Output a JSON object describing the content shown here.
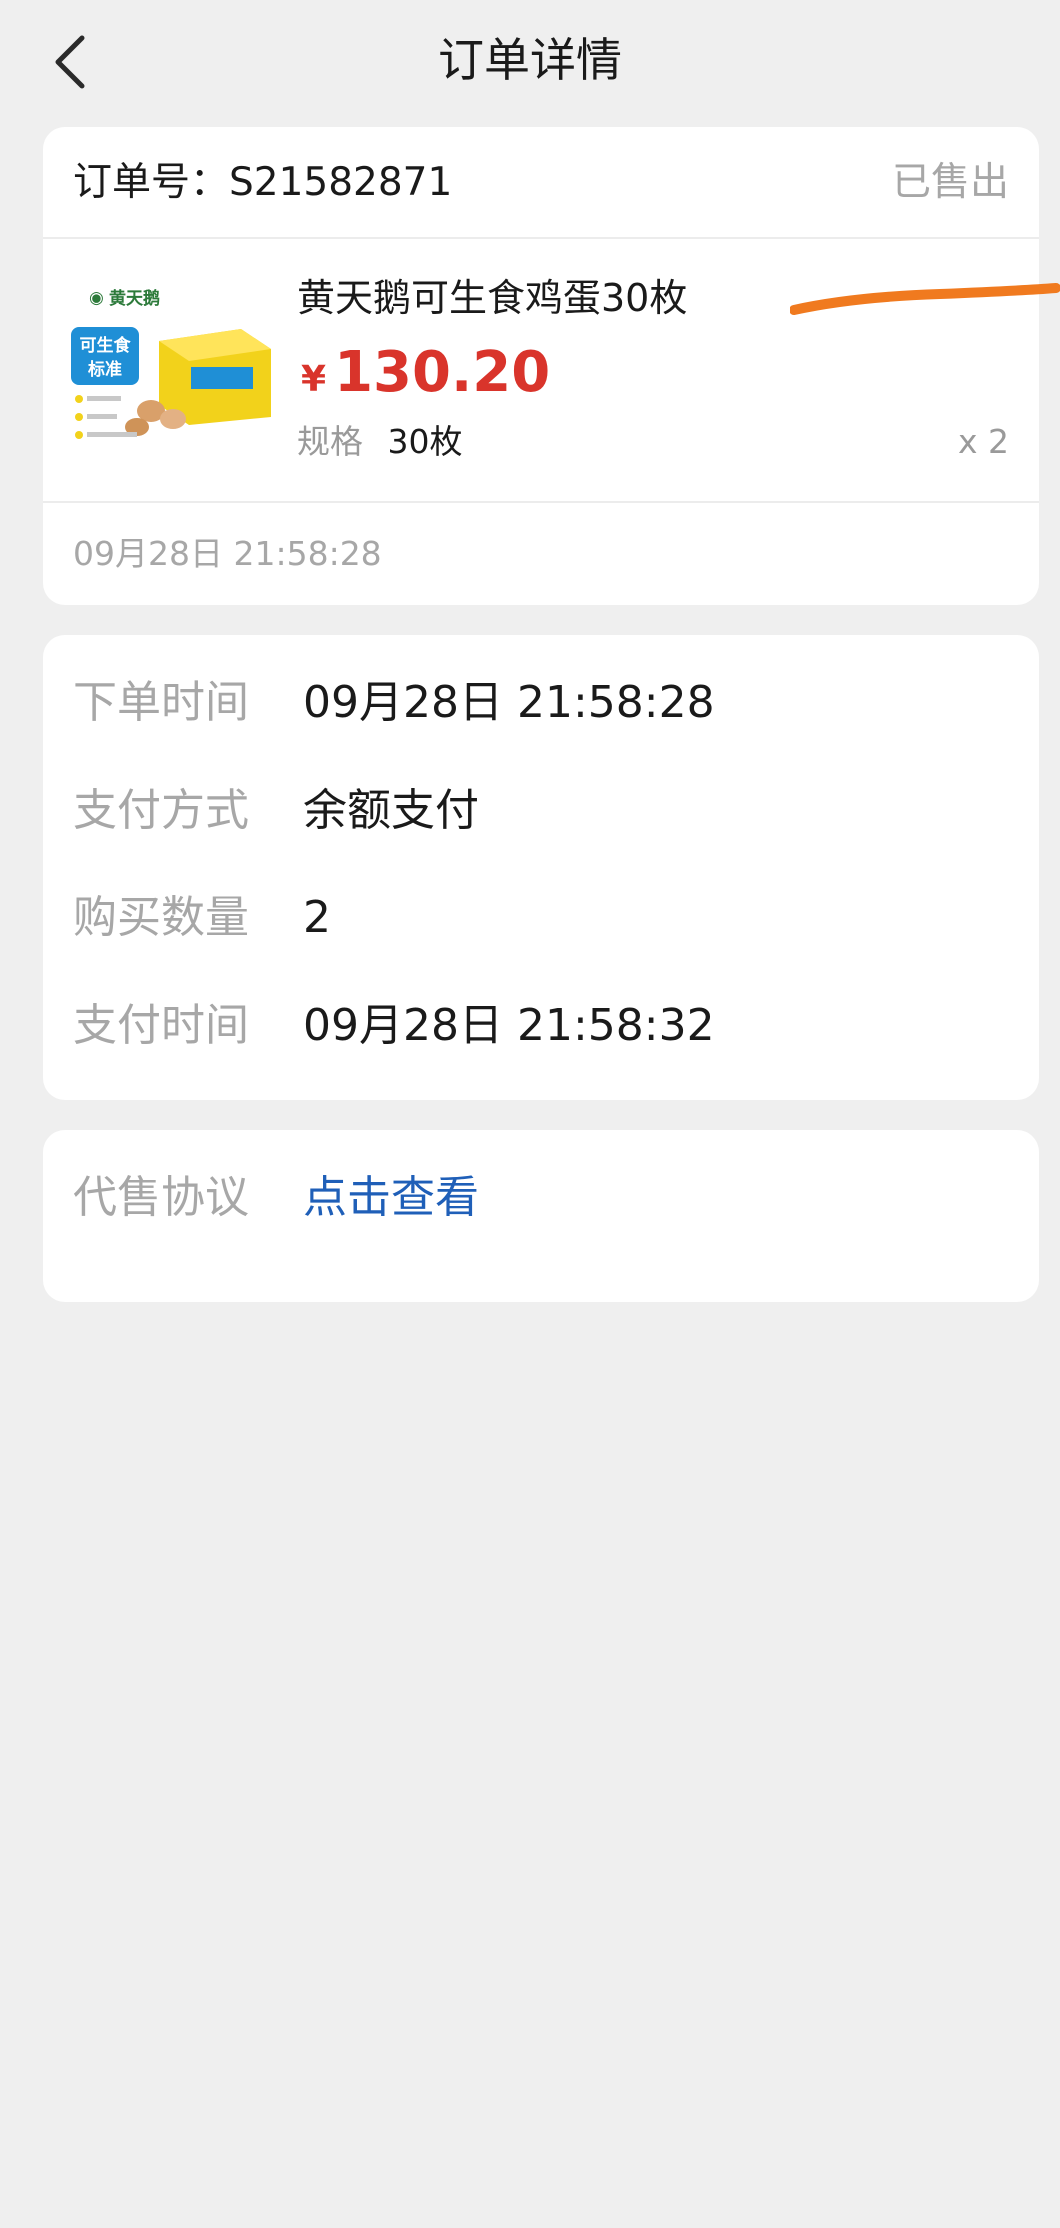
{
  "header": {
    "title": "订单详情"
  },
  "order": {
    "label": "订单号：S21582871",
    "status": "已售出",
    "product": {
      "name": "黄天鹅可生食鸡蛋30枚",
      "currency": "¥",
      "price": "130.20",
      "spec_label": "规格",
      "spec_value": "30枚",
      "quantity": "x 2",
      "thumb_brand": "黄天鹅",
      "thumb_tag": "可生食标准"
    },
    "time": "09月28日 21:58:28"
  },
  "details": [
    {
      "label": "下单时间",
      "value": "09月28日 21:58:28"
    },
    {
      "label": "支付方式",
      "value": "余额支付"
    },
    {
      "label": "购买数量",
      "value": "2"
    },
    {
      "label": "支付时间",
      "value": "09月28日 21:58:32"
    }
  ],
  "agreement": {
    "label": "代售协议",
    "link": "点击查看"
  },
  "colors": {
    "background": "#efefef",
    "price": "#d9342b",
    "link": "#1f5fb8",
    "muted": "#a7a7a7",
    "marker": "#f07a1f"
  }
}
